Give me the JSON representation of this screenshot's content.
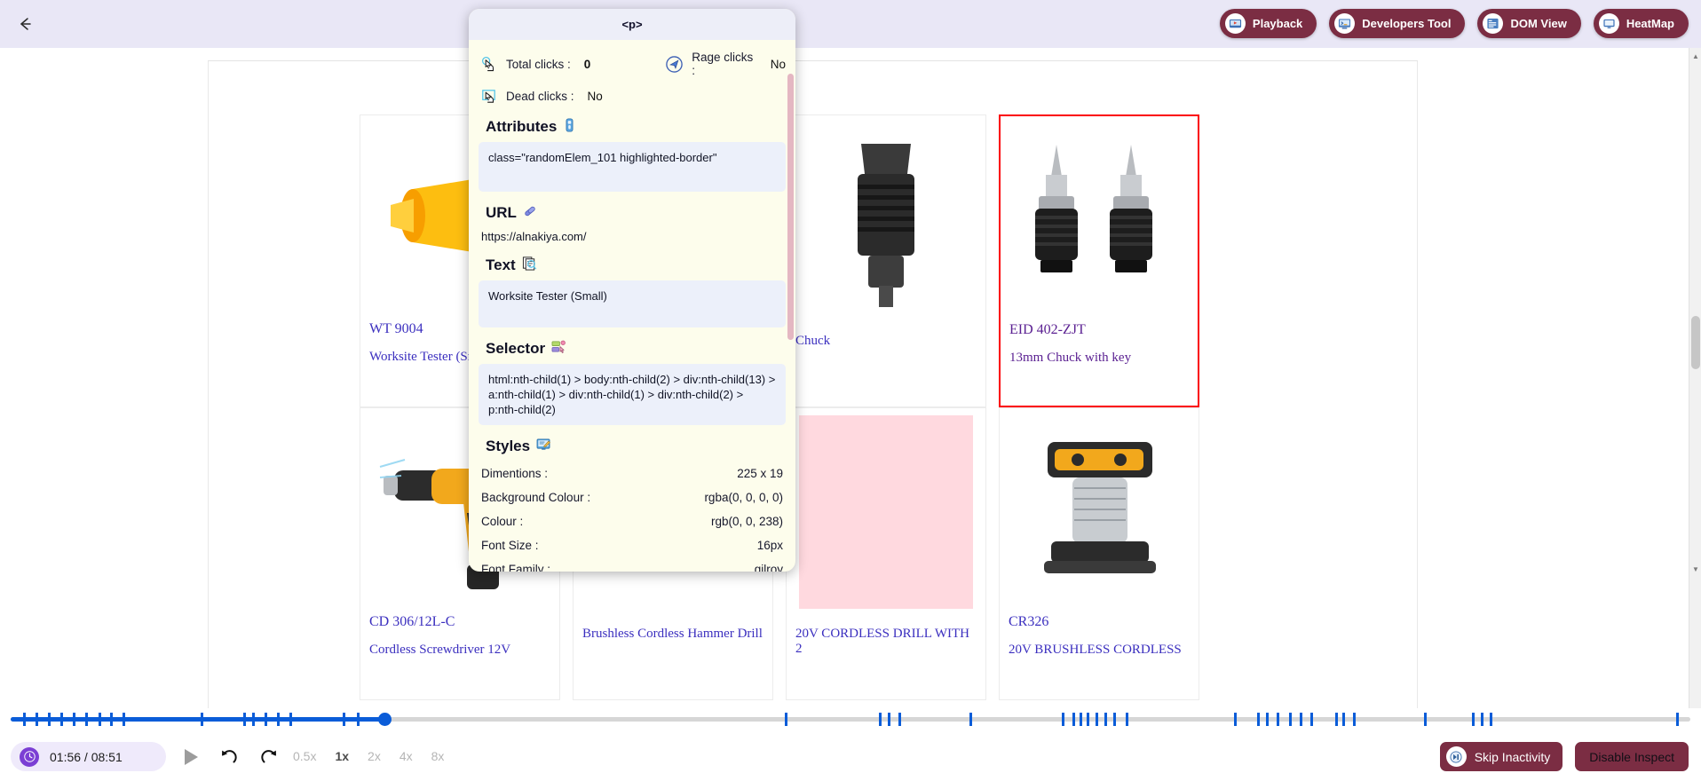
{
  "topbar": {
    "back_icon": "arrow-left-icon",
    "buttons": [
      {
        "label": "Playback",
        "icon": "playback-icon"
      },
      {
        "label": "Developers Tool",
        "icon": "developers-tool-icon"
      },
      {
        "label": "DOM View",
        "icon": "dom-view-icon"
      },
      {
        "label": "HeatMap",
        "icon": "heatmap-icon"
      }
    ]
  },
  "inspector": {
    "tag": "<p>",
    "metrics": [
      {
        "label": "Total clicks :",
        "value": "0",
        "icon": "pointer-click-icon"
      },
      {
        "label": "Rage clicks :",
        "value": "No",
        "icon": "rage-click-icon"
      },
      {
        "label": "Dead clicks :",
        "value": "No",
        "icon": "dead-click-icon"
      }
    ],
    "sections": {
      "attributes": {
        "title": "Attributes",
        "icon": "tag-emoji-icon",
        "value": "class=\"randomElem_101 highlighted-border\""
      },
      "url": {
        "title": "URL",
        "icon": "link-emoji-icon",
        "value": "https://alnakiya.com/"
      },
      "text": {
        "title": "Text",
        "icon": "text-search-emoji-icon",
        "value": "Worksite Tester (Small)"
      },
      "selector": {
        "title": "Selector",
        "icon": "selector-emoji-icon",
        "value": "html:nth-child(1) > body:nth-child(2) > div:nth-child(13) > a:nth-child(1) > div:nth-child(1) > div:nth-child(2) > p:nth-child(2)"
      },
      "styles": {
        "title": "Styles",
        "icon": "styles-emoji-icon",
        "rows": [
          {
            "label": "Dimentions :",
            "value": "225 x 19"
          },
          {
            "label": "Background Colour :",
            "value": "rgba(0, 0, 0, 0)"
          },
          {
            "label": "Colour :",
            "value": "rgb(0, 0, 238)"
          },
          {
            "label": "Font Size :",
            "value": "16px"
          },
          {
            "label": "Font Family :",
            "value": "gilroy"
          }
        ]
      }
    }
  },
  "products": [
    {
      "sku": "WT 9004",
      "name": "Worksite Tester (Small)",
      "art": "cone",
      "selected": false
    },
    {
      "sku": "",
      "name": "",
      "art": "blank",
      "selected": false
    },
    {
      "sku": "",
      "name": "Chuck",
      "art": "blackdrill",
      "selected": false
    },
    {
      "sku": "EID 402-ZJT",
      "name": "13mm Chuck with key",
      "art": "chucks",
      "selected": true
    },
    {
      "sku": "CD 306/12L-C",
      "name": "Cordless Screwdriver 12V",
      "art": "drill",
      "selected": false
    },
    {
      "sku": "",
      "name": "Brushless Cordless Hammer Drill",
      "art": "blank",
      "selected": false
    },
    {
      "sku": "",
      "name": "20V CORDLESS DRILL WITH 2",
      "art": "pink",
      "selected": false
    },
    {
      "sku": "CR326",
      "name": "20V BRUSHLESS CORDLESS",
      "art": "router",
      "selected": false
    }
  ],
  "player": {
    "time_current": "01:56",
    "time_total": "08:51",
    "time_display": "01:56 / 08:51",
    "clock_icon": "clock-icon",
    "play_icon": "play-icon",
    "rewind_icon": "rewind-10-icon",
    "forward_icon": "forward-10-icon",
    "speeds": [
      "0.5x",
      "1x",
      "2x",
      "4x",
      "8x"
    ],
    "active_speed": "1x",
    "buttons": [
      {
        "label": "Skip Inactivity",
        "icon": "skip-inactivity-icon",
        "style": "filled"
      },
      {
        "label": "Disable Inspect",
        "icon": "",
        "style": "filled"
      }
    ]
  },
  "colors": {
    "accent": "#7b2d43",
    "topbar_bg": "#e9e7f6",
    "panel_bg": "#fdfdec",
    "panel_head_bg": "#edeef8",
    "box_bg": "#ecf0fa",
    "timeline": "#0a5cd8",
    "selected_border": "#fb0007",
    "link": "#3b2fbf"
  }
}
